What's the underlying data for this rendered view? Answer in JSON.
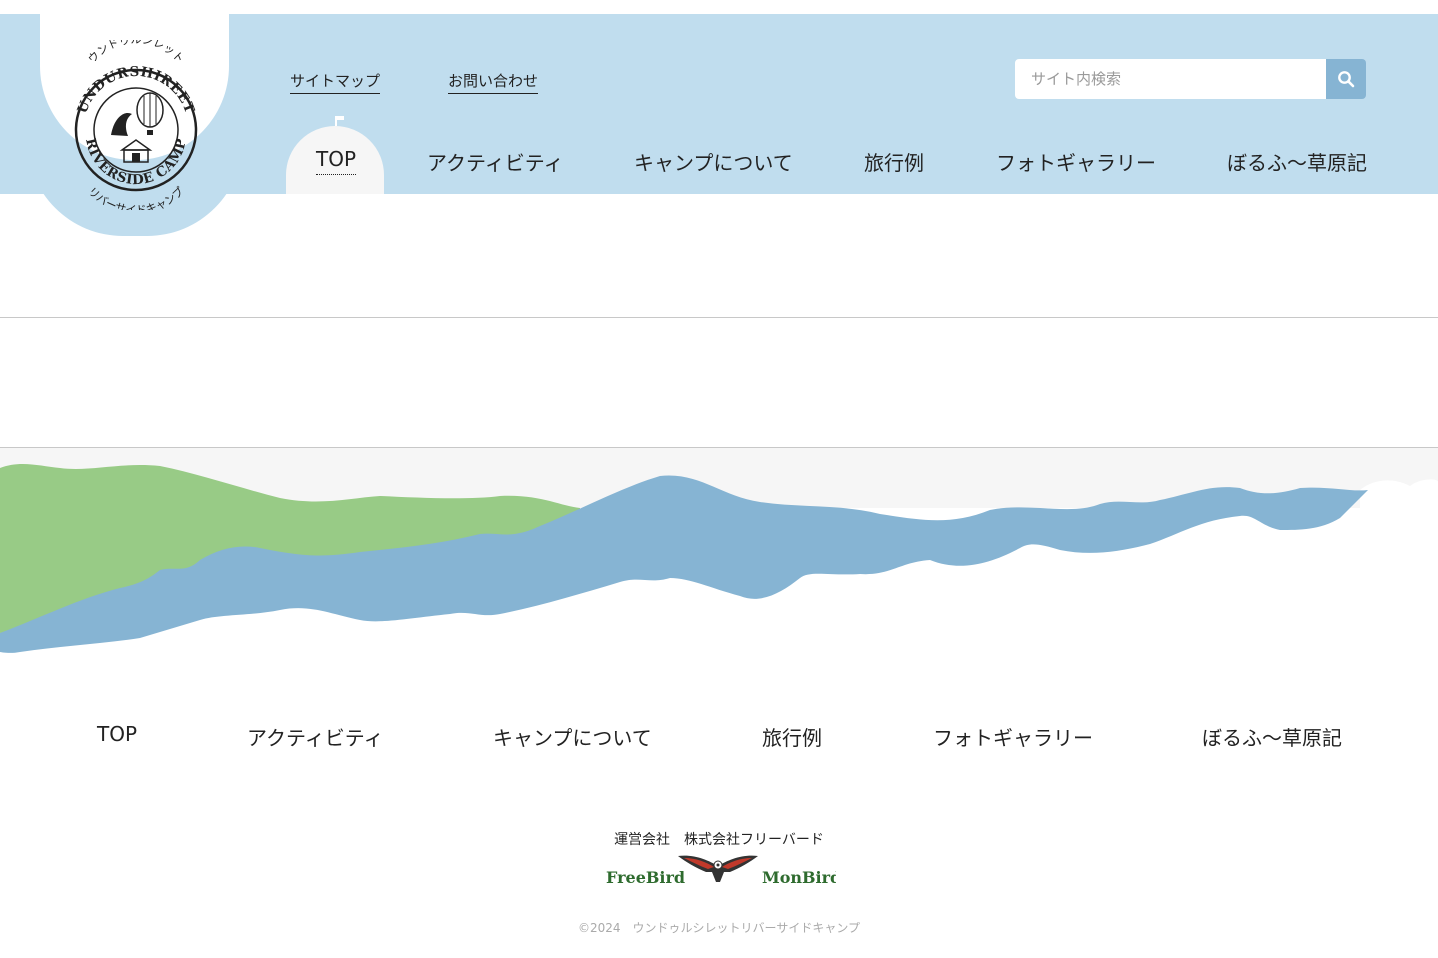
{
  "header": {
    "logo": {
      "alt": "ウンドゥルシレットリバーサイドキャンプ",
      "arc_top": "ウンドゥルシレット",
      "ring_text": "UNDURSHIREET RIVERSIDE CAMP",
      "arc_bottom": "リバーサイドキャンプ"
    },
    "utility_links": [
      "サイトマップ",
      "お問い合わせ"
    ],
    "search": {
      "placeholder": "サイト内検索",
      "icon": "search-icon"
    },
    "nav": [
      {
        "label": "TOP",
        "active": true
      },
      {
        "label": "アクティビティ"
      },
      {
        "label": "キャンプについて"
      },
      {
        "label": "旅行例"
      },
      {
        "label": "フォトギャラリー"
      },
      {
        "label": "ぼるふ〜草原記"
      }
    ]
  },
  "footer": {
    "nav": [
      "TOP",
      "アクティビティ",
      "キャンプについて",
      "旅行例",
      "フォトギャラリー",
      "ぼるふ〜草原記"
    ],
    "company": "運営会社　株式会社フリーバード",
    "brand": {
      "left": "FreeBird",
      "right": "MonBird"
    },
    "copyright": "©2024　ウンドゥルシレットリバーサイドキャンプ"
  },
  "colors": {
    "header_bg": "#c0ddee",
    "search_button": "#86b4d3",
    "hill_green": "#98cb86",
    "hill_blue": "#86b4d3",
    "brand_green": "#2e6b2e"
  }
}
